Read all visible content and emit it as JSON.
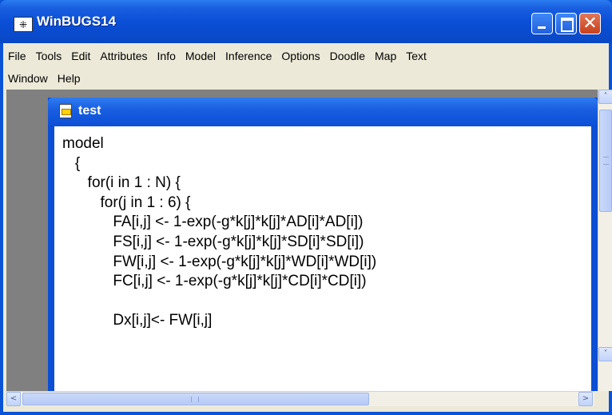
{
  "app": {
    "title": "WinBUGS14",
    "icon_glyph": "⁜",
    "title_bar_color": "#0a4fd6"
  },
  "window_controls": {
    "minimize_icon": "minimize-icon",
    "maximize_icon": "maximize-icon",
    "close_glyph": "✕"
  },
  "menubar": {
    "row1": [
      "File",
      "Tools",
      "Edit",
      "Attributes",
      "Info",
      "Model",
      "Inference",
      "Options",
      "Doodle",
      "Map",
      "Text"
    ],
    "row2": [
      "Window",
      "Help"
    ]
  },
  "document": {
    "title": "test",
    "code_lines": [
      "model",
      "   {",
      "      for(i in 1 : N) {",
      "         for(j in 1 : 6) {",
      "            FA[i,j] <- 1-exp(-g*k[j]*k[j]*AD[i]*AD[i])",
      "            FS[i,j] <- 1-exp(-g*k[j]*k[j]*SD[i]*SD[i])",
      "            FW[i,j] <- 1-exp(-g*k[j]*k[j]*WD[i]*WD[i])",
      "            FC[i,j] <- 1-exp(-g*k[j]*k[j]*CD[i]*CD[i])",
      "",
      "            Dx[i,j]<- FW[i,j]"
    ]
  },
  "scrollbars": {
    "up_glyph": "˄",
    "down_glyph": "˅",
    "left_glyph": "<",
    "right_glyph": ">"
  }
}
